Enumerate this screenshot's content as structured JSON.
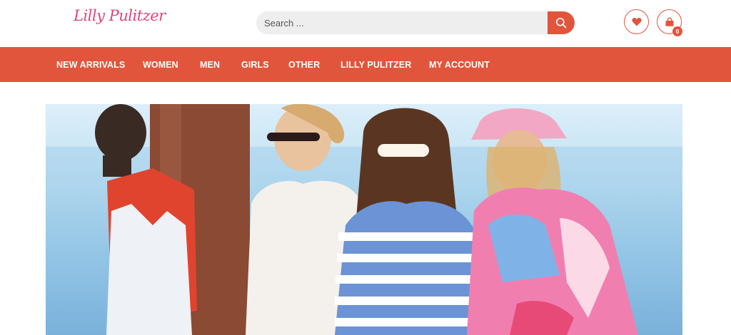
{
  "brand": {
    "logo_text": "Lilly Pulitzer",
    "accent_color": "#e2553d",
    "logo_color": "#e0457b"
  },
  "search": {
    "placeholder": "Search ...",
    "icon": "search-icon"
  },
  "header_actions": {
    "wishlist_icon": "heart-icon",
    "cart_icon": "shopping-bag-icon",
    "cart_count": "0"
  },
  "nav": {
    "items": [
      {
        "label": "NEW ARRIVALS"
      },
      {
        "label": "WOMEN"
      },
      {
        "label": "MEN"
      },
      {
        "label": "GIRLS"
      },
      {
        "label": "OTHER"
      },
      {
        "label": "LILLY PULITZER"
      },
      {
        "label": "MY ACCOUNT"
      }
    ]
  },
  "hero": {
    "image": "hero-photo-models-beach"
  }
}
